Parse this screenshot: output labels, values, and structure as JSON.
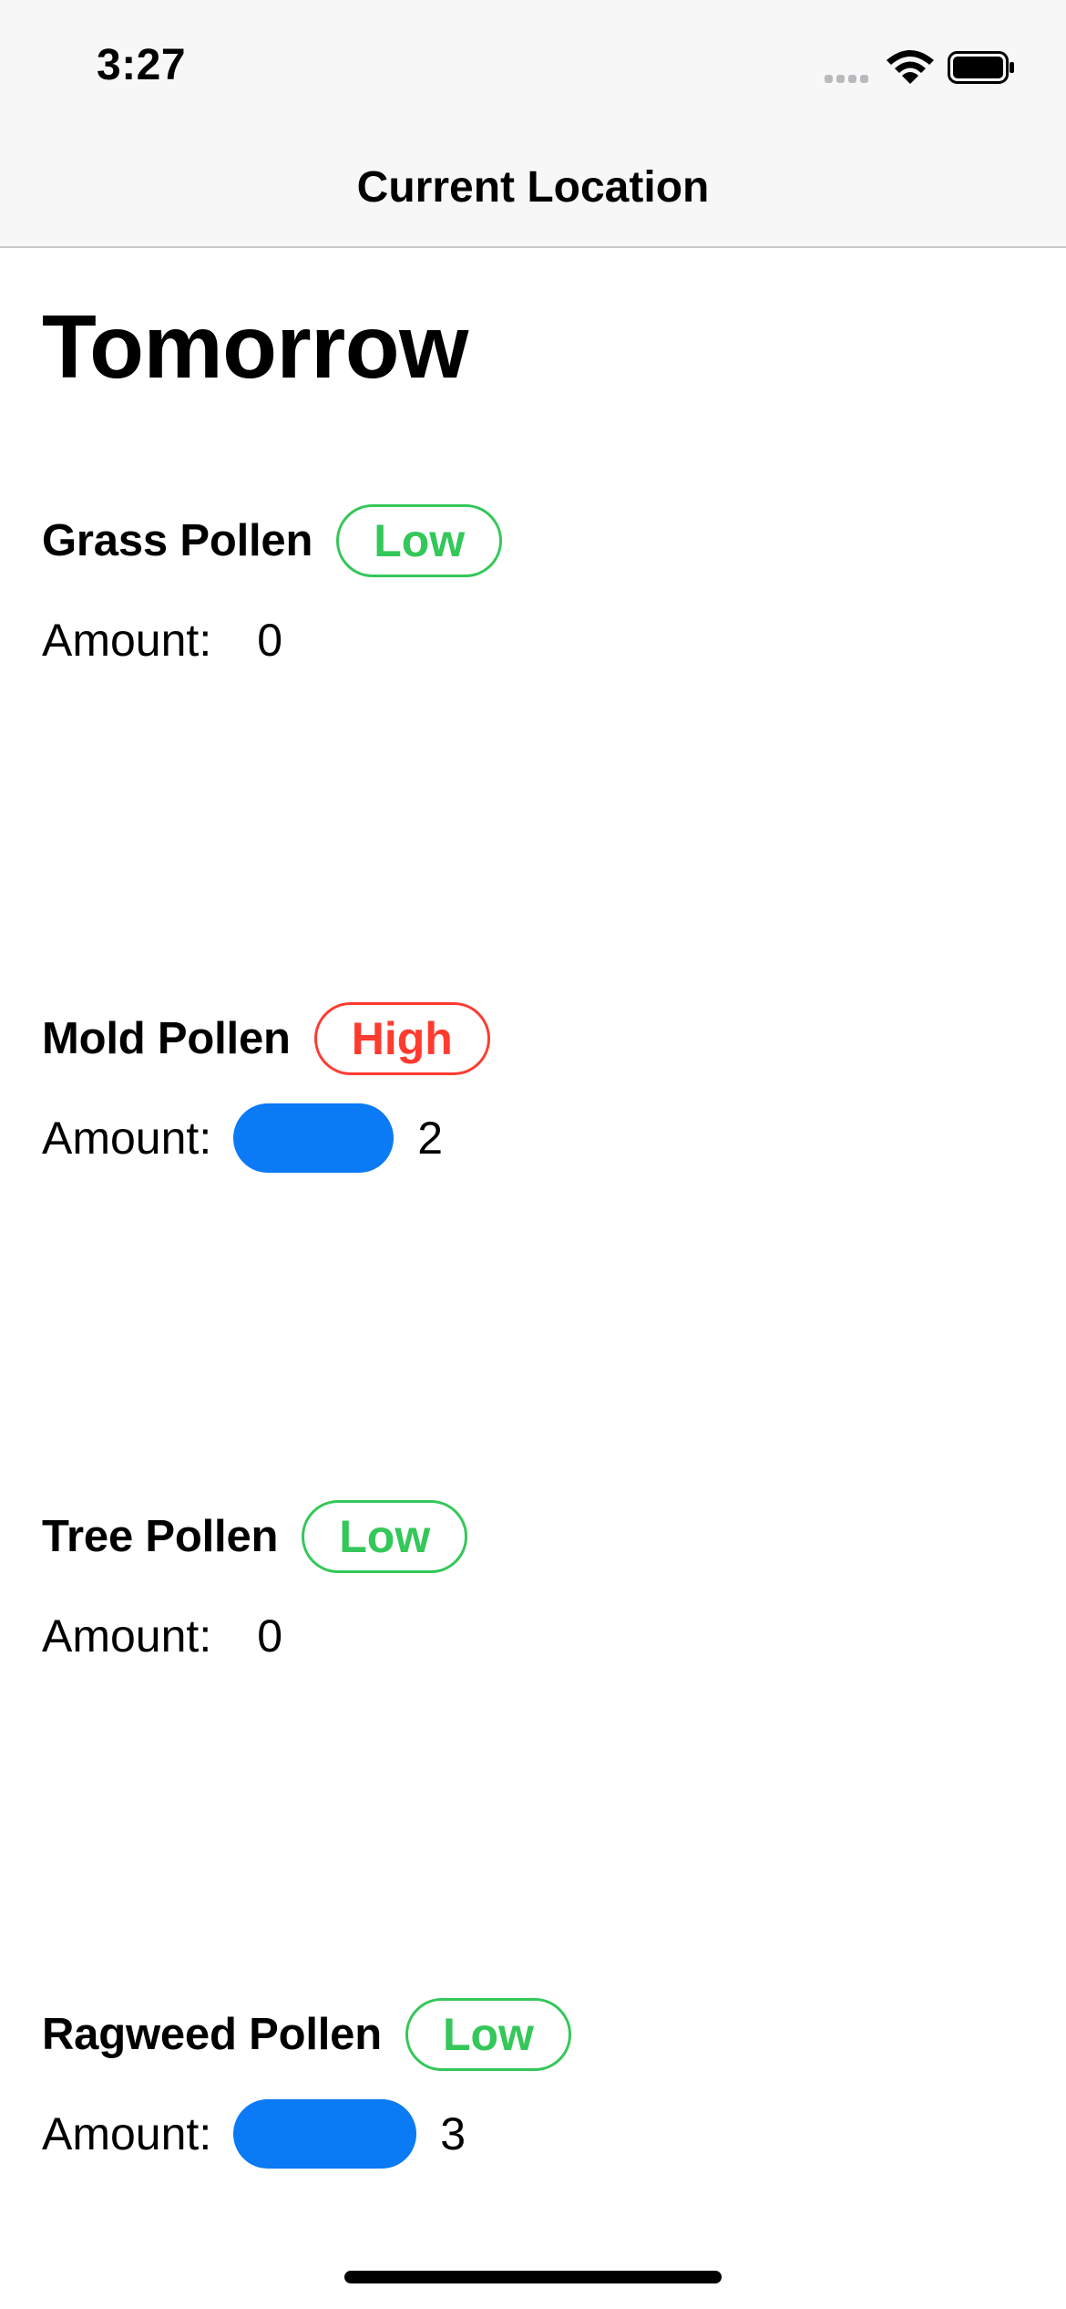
{
  "status_bar": {
    "time": "3:27"
  },
  "nav": {
    "title": "Current Location"
  },
  "page": {
    "title": "Tomorrow"
  },
  "amount_label": "Amount:",
  "sections": [
    {
      "name": "Grass Pollen",
      "level": "Low",
      "level_color": "#34c759",
      "amount": "0",
      "bar_fraction": 0
    },
    {
      "name": "Mold Pollen",
      "level": "High",
      "level_color": "#ff3b30",
      "amount": "2",
      "bar_fraction": 0.667
    },
    {
      "name": "Tree Pollen",
      "level": "Low",
      "level_color": "#34c759",
      "amount": "0",
      "bar_fraction": 0
    },
    {
      "name": "Ragweed Pollen",
      "level": "Low",
      "level_color": "#34c759",
      "amount": "3",
      "bar_fraction": 0.763
    }
  ],
  "colors": {
    "accent_blue": "#0a7af5",
    "low_green": "#34c759",
    "high_red": "#ff3b30"
  },
  "icons": [
    "signal-dots-icon",
    "wifi-icon",
    "battery-icon"
  ]
}
